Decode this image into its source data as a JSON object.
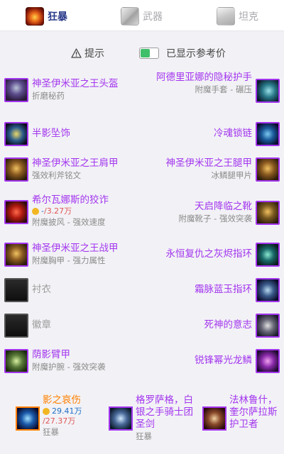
{
  "tabs": [
    {
      "label": "狂暴",
      "active": true
    },
    {
      "label": "武器",
      "active": false
    },
    {
      "label": "坦克",
      "active": false
    }
  ],
  "toolbar": {
    "hint_label": "提示",
    "price_toggle_label": "已显示参考价",
    "price_toggle_on": true
  },
  "items": [
    {
      "name": "神圣伊米亚之王头盔",
      "sub": "折磨秘药"
    },
    {
      "name": "阿德里亚娜的隐秘护手",
      "sub": "附魔手套 - 碾压"
    },
    {
      "name": "半影坠饰",
      "sub": ""
    },
    {
      "name": "冷魂锁链",
      "sub": ""
    },
    {
      "name": "神圣伊米亚之王肩甲",
      "sub": "强效利斧铭文"
    },
    {
      "name": "神圣伊米亚之王腿甲",
      "sub": "冰鳞腿甲片"
    },
    {
      "name": "希尔瓦娜斯的狡诈",
      "price": {
        "current": "-",
        "max": "/3.27万"
      },
      "sub": "附魔披风 - 强效速度"
    },
    {
      "name": "天启降临之靴",
      "sub": "附魔靴子 - 强效突袭"
    },
    {
      "name": "神圣伊米亚之王战甲",
      "sub": "附魔胸甲 - 强力属性"
    },
    {
      "name": "永恒复仇之灰烬指环",
      "sub": ""
    },
    {
      "name": "衬衣",
      "sub": ""
    },
    {
      "name": "霜脉蓝玉指环",
      "sub": ""
    },
    {
      "name": "徽章",
      "sub": ""
    },
    {
      "name": "死神的意志",
      "sub": ""
    },
    {
      "name": "荫影臂甲",
      "sub": "附魔护腕 - 强效突袭"
    },
    {
      "name": "锐锋幂光龙鳞",
      "sub": ""
    }
  ],
  "weapons": [
    {
      "name": "影之哀伤",
      "price": {
        "current": "29.41万",
        "max": "/27.37万"
      },
      "sub": "狂暴"
    },
    {
      "name": "格罗萨格，白银之手骑士团圣剑",
      "sub": "狂暴"
    },
    {
      "name": "法林鲁什，奎尔萨拉斯护卫者",
      "sub": ""
    }
  ],
  "colors": {
    "epic": "#a335ee",
    "legendary": "#ff8000",
    "common": "#9d9d9d",
    "accent": "#2a3a8a"
  },
  "icons": [
    "warrior-fury-icon",
    "warrior-arms-icon",
    "warrior-protection-icon",
    "warning-icon",
    "gold-coin-icon"
  ]
}
